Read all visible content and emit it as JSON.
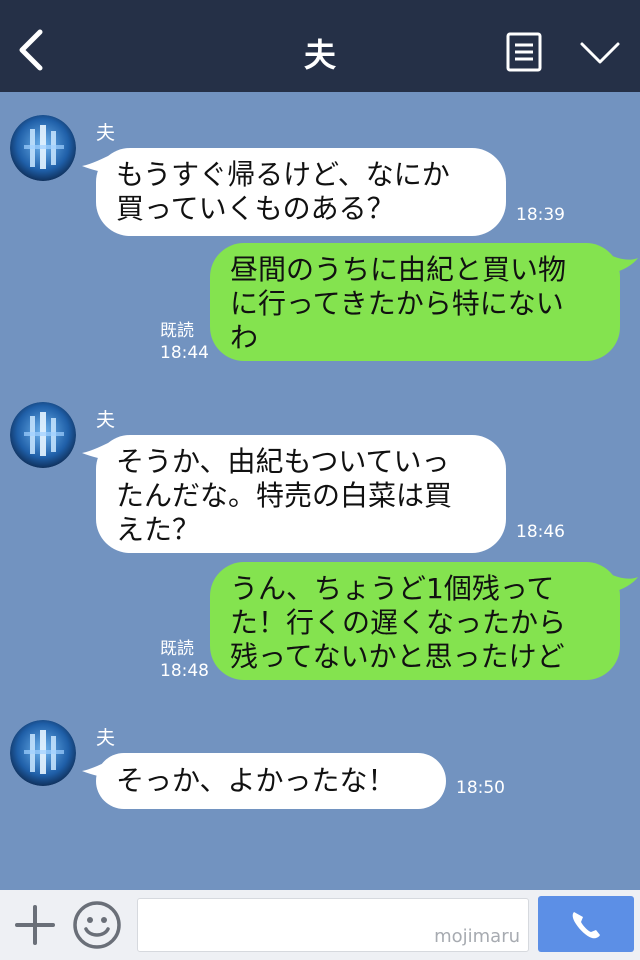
{
  "header": {
    "title": "夫"
  },
  "messages": [
    {
      "sender": "夫",
      "lines": [
        "もうすぐ帰るけど、なにか",
        "買っていくものある？"
      ],
      "time": "18:39"
    },
    {
      "lines": [
        "昼間のうちに由紀と買い物",
        "に行ってきたから特にない",
        "わ"
      ],
      "read": "既読",
      "time": "18:44"
    },
    {
      "sender": "夫",
      "lines": [
        "そうか、由紀もついていっ",
        "たんだな。特売の白菜は買",
        "えた？"
      ],
      "time": "18:46"
    },
    {
      "lines": [
        "うん、ちょうど1個残って",
        "た！行くの遅くなったから",
        "残ってないかと思ったけど"
      ],
      "read": "既読",
      "time": "18:48"
    },
    {
      "sender": "夫",
      "lines": [
        "そっか、よかったな！"
      ],
      "time": "18:50"
    }
  ],
  "footer": {
    "watermark": "mojimaru",
    "input_value": ""
  },
  "colors": {
    "header_bg": "#253047",
    "chat_bg": "#7293c0",
    "incoming_bubble": "#ffffff",
    "outgoing_bubble": "#84e34f",
    "call_button": "#5c8fe6"
  },
  "icons": {
    "back": "chevron-left-icon",
    "menu": "list-icon",
    "collapse": "chevron-down-icon",
    "add": "plus-icon",
    "emoji": "smiley-icon",
    "call": "phone-icon"
  }
}
